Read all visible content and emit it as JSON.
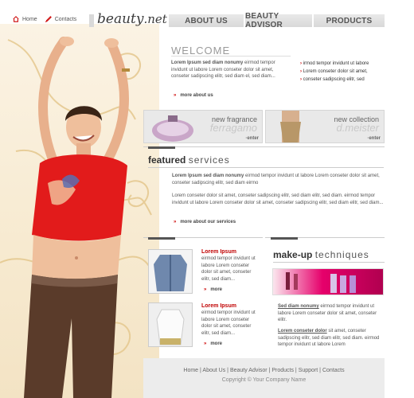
{
  "topnav": {
    "home": "Home",
    "contacts": "Contacts"
  },
  "logo": {
    "name": "beauty",
    "tld": ".net"
  },
  "nav": {
    "about": "ABOUT US",
    "advisor": "BEAUTY ADVISOR",
    "products": "PRODUCTS"
  },
  "welcome": {
    "title": "WELCOME",
    "lead": "Lorem Ipsum sed diam nonumy",
    "text": " eirmod tempor invidunt ut labore Lorem conseter dolor sit amet, conseter sadipscing elitr, sed diam el, sed diam...",
    "more": "more about us",
    "bullets": [
      "irmod tempor invidunt ut labore",
      "Lorem conseter dolor sit amet,",
      "conseter sadipscing elitr, sed"
    ]
  },
  "promos": [
    {
      "line1": "new fragrance",
      "line2": "ferragamo",
      "enter": "·enter"
    },
    {
      "line1": "new collection",
      "line2": "d.meister",
      "enter": "·enter"
    }
  ],
  "featured": {
    "title_bold": "featured",
    "title_light": "services",
    "lead": "Lorem Ipsum sed diam nonumy",
    "p1": " eirmod tempor invidunt ut labore Lorem conseter dolor sit amet, conseter sadipscing elitr, sed diam eirmo",
    "p2": "Lorem conseter dolor sit amet, conseter sadipscing elitr, sed diam  elitr, sed diam. eirmod tempor invidunt ut labore Lorem conseter dolor sit amet, conseter sadipscing elitr, sed diam  elitr, sed diam...",
    "more": "more about our services"
  },
  "products": [
    {
      "title": "Lorem Ipsum",
      "text": "eirmod tempor invidunt ut labore Lorem conseter dolor sit amet, conseter elitr, sed diam...",
      "more": "more"
    },
    {
      "title": "Lorem Ipsum",
      "text": "eirmod tempor invidunt ut labore Lorem conseter dolor sit amet, conseter elitr, sed diam...",
      "more": "more"
    }
  ],
  "makeup": {
    "title_bold": "make-up",
    "title_light": "techniques",
    "p1_lead": "Sed diam nonumy",
    "p1": " eirmod tempor invidunt ut labore Lorem conseter dolor sit amet, conseter elitr.",
    "p2_lead": "Lorem conseter dolor",
    "p2": " sit amet, conseter sadipscing elitr, sed diam  elitr, sed diam. eirmod tempor invidunt ut labore Lorem"
  },
  "footer": {
    "links": [
      "Home",
      "About Us",
      "Beauty Advisor",
      "Products",
      "Support",
      "Contacts"
    ],
    "sep": " | ",
    "copyright": "Copyright © Your Company Name"
  },
  "colors": {
    "accent": "#c00000",
    "nav_bg": "#dcdcdc",
    "hero_top": "#ef2a2a"
  }
}
